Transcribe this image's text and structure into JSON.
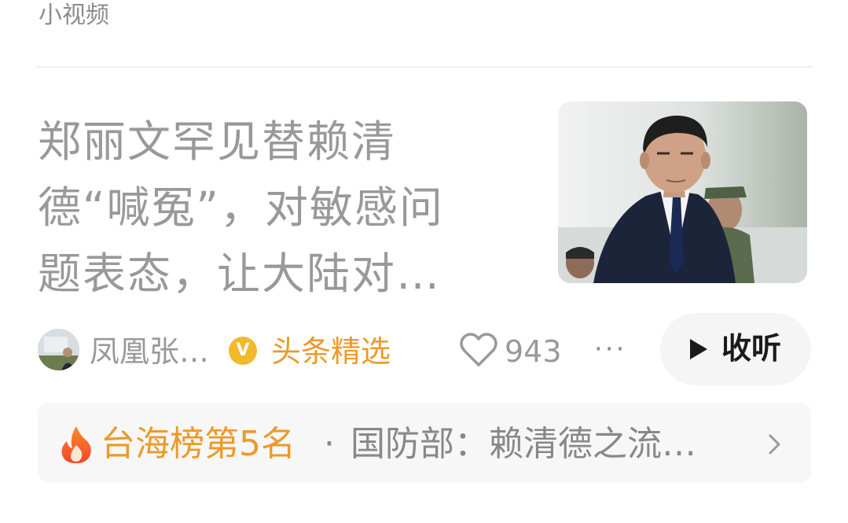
{
  "section": {
    "label": "小视频"
  },
  "article": {
    "headline_lines": [
      "郑丽文罕见替赖清",
      "德“喊冤”，对敏感问",
      "题表态，让大陆对…"
    ],
    "author": "凤凰张…",
    "channel": "头条精选",
    "likes": "943",
    "more": "···",
    "listen_label": "收听"
  },
  "hot_bar": {
    "rank": "台海榜第5名",
    "separator": "·",
    "topic": "国防部：赖清德之流…"
  },
  "colors": {
    "accent": "#eb9a2b",
    "verify": "#f2b92b",
    "text_muted": "#999999"
  },
  "icons": [
    "verified-icon",
    "heart-icon",
    "more-icon",
    "play-icon",
    "fire-icon",
    "chevron-right-icon"
  ]
}
